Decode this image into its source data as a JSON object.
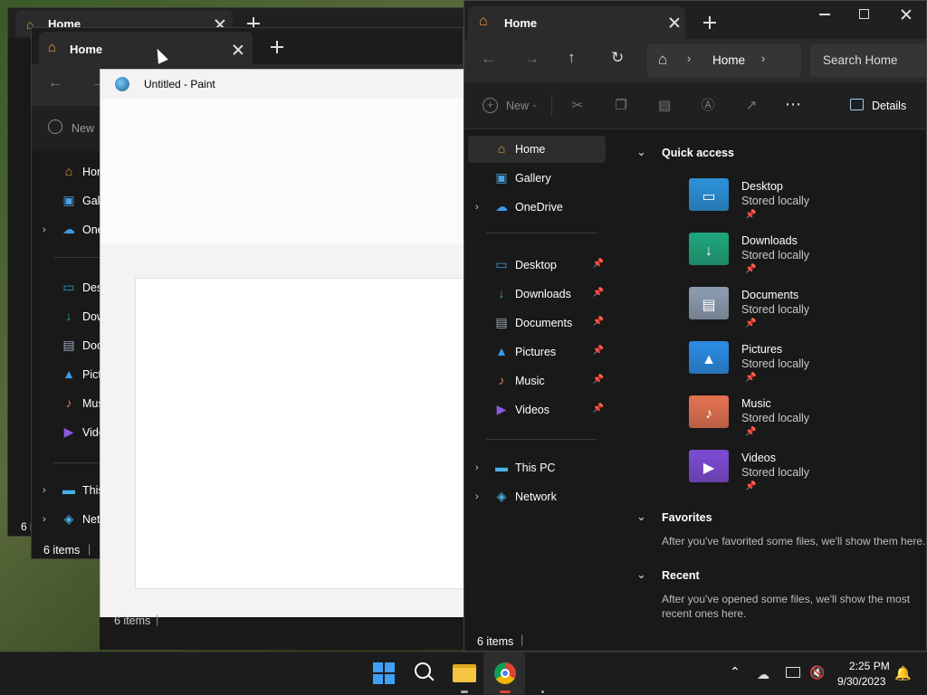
{
  "back_window_1": {
    "tab_title": "Home",
    "status_text": "6 i"
  },
  "back_window_2": {
    "tab_title": "Home",
    "new_label": "New",
    "nav": [
      {
        "label": "Hon",
        "icon": "home-icon"
      },
      {
        "label": "Gall",
        "icon": "gallery-icon"
      },
      {
        "label": "One",
        "icon": "onedrive-icon"
      },
      {
        "label": "Desk",
        "icon": "desktop-icon"
      },
      {
        "label": "Dow",
        "icon": "downloads-icon"
      },
      {
        "label": "Doc",
        "icon": "documents-icon"
      },
      {
        "label": "Pict",
        "icon": "pictures-icon"
      },
      {
        "label": "Mus",
        "icon": "music-icon"
      },
      {
        "label": "Vide",
        "icon": "videos-icon"
      },
      {
        "label": "This",
        "icon": "thispc-icon"
      },
      {
        "label": "Netw",
        "icon": "network-icon"
      }
    ],
    "status_text": "6 items"
  },
  "paint": {
    "title": "Untitled - Paint",
    "status_text": "6 items"
  },
  "explorer": {
    "tab_title": "Home",
    "breadcrumb": "Home",
    "search_placeholder": "Search Home",
    "new_label": "New",
    "details_label": "Details",
    "nav": [
      {
        "label": "Home",
        "icon": "home-icon",
        "selected": true
      },
      {
        "label": "Gallery",
        "icon": "gallery-icon"
      },
      {
        "label": "OneDrive",
        "icon": "onedrive-icon",
        "expandable": true
      },
      {
        "label": "Desktop",
        "icon": "desktop-icon",
        "pinned": true
      },
      {
        "label": "Downloads",
        "icon": "downloads-icon",
        "pinned": true
      },
      {
        "label": "Documents",
        "icon": "documents-icon",
        "pinned": true
      },
      {
        "label": "Pictures",
        "icon": "pictures-icon",
        "pinned": true
      },
      {
        "label": "Music",
        "icon": "music-icon",
        "pinned": true
      },
      {
        "label": "Videos",
        "icon": "videos-icon",
        "pinned": true
      },
      {
        "label": "This PC",
        "icon": "thispc-icon",
        "expandable": true
      },
      {
        "label": "Network",
        "icon": "network-icon",
        "expandable": true
      }
    ],
    "quick_access_title": "Quick access",
    "folders": [
      {
        "name": "Desktop",
        "sub": "Stored locally",
        "color": "#2b8fd6"
      },
      {
        "name": "Downloads",
        "sub": "Stored locally",
        "color": "#1fa37a"
      },
      {
        "name": "Documents",
        "sub": "Stored locally",
        "color": "#8a9aad"
      },
      {
        "name": "Pictures",
        "sub": "Stored locally",
        "color": "#2a8ae0"
      },
      {
        "name": "Music",
        "sub": "Stored locally",
        "color": "#e07050"
      },
      {
        "name": "Videos",
        "sub": "Stored locally",
        "color": "#7a4ad0"
      }
    ],
    "favorites_title": "Favorites",
    "favorites_text": "After you've favorited some files, we'll show them here.",
    "recent_title": "Recent",
    "recent_text_1": "After you've opened some files, we'll show the most",
    "recent_text_2": "recent ones here.",
    "status_text": "6 items"
  },
  "taskbar": {
    "time": "2:25 PM",
    "date": "9/30/2023"
  },
  "colors": {
    "accent": "#0078d4",
    "folder_blue": "#2b8fd6"
  }
}
